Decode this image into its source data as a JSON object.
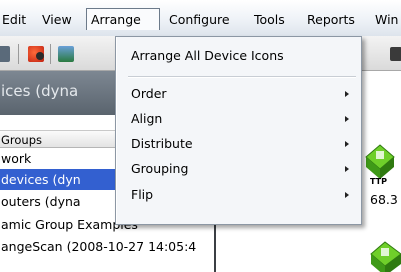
{
  "menubar": {
    "items": [
      "Edit",
      "View",
      "Arrange",
      "Configure",
      "Tools",
      "Reports",
      "Win"
    ],
    "active": "Arrange"
  },
  "toolbar": {
    "icons": [
      "toolbar-icon-a",
      "toolbar-icon-b",
      "toolbar-icon-c",
      "toolbar-icon-d"
    ]
  },
  "left": {
    "title": "ices (dyna",
    "groups_header": "Groups",
    "rows": [
      "work",
      "devices (dyn",
      "outers (dyna",
      "amic Group Examples",
      "angeScan (2008-10-27 14:05:4"
    ],
    "selected_index": 1
  },
  "right": {
    "node_labels": [
      "TTP",
      "68.3"
    ]
  },
  "dropdown": {
    "first_item": "Arrange All Device Icons",
    "items": [
      {
        "label": "Order",
        "submenu": true
      },
      {
        "label": "Align",
        "submenu": true
      },
      {
        "label": "Distribute",
        "submenu": true
      },
      {
        "label": "Grouping",
        "submenu": true
      },
      {
        "label": "Flip",
        "submenu": true
      }
    ]
  },
  "colors": {
    "selection": "#3360d0",
    "menu_bg": "#f4f6f9",
    "title_band": "#6b7580"
  }
}
